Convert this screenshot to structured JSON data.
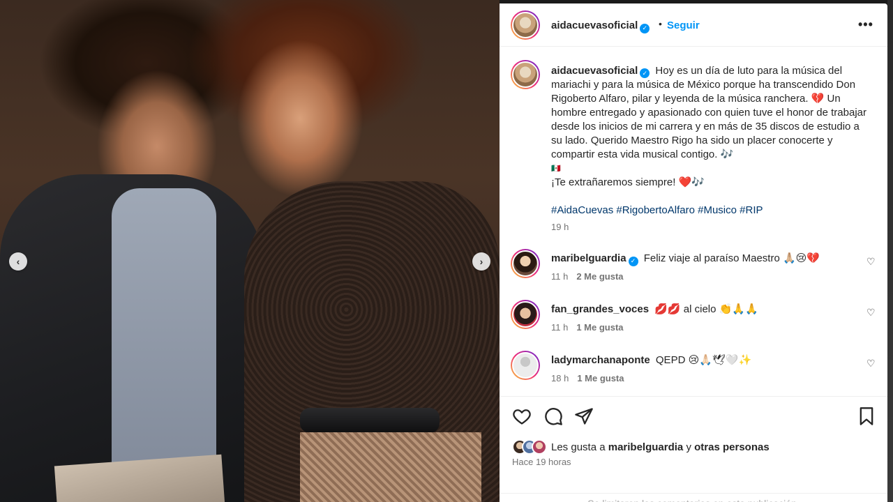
{
  "post": {
    "username": "aidacuevasoficial",
    "follow_label": "Seguir",
    "more_label": "•••",
    "dot": "•"
  },
  "caption": {
    "username": "aidacuevasoficial",
    "line1": "Hoy es un día de luto para la música del mariachi y para la música de México porque ha transcendido Don Rigoberto Alfaro, pilar y leyenda de la música ranchera. 💔 Un hombre entregado y apasionado con quien tuve el honor de trabajar desde los inicios de mi carrera y en más de 35 discos de estudio a su lado. Querido Maestro Rigo ha sido un placer conocerte y compartir esta vida musical contigo. 🎶",
    "flag": "🇲🇽",
    "line2": "¡Te extrañaremos siempre! ❤️🎶",
    "hashtags": "#AidaCuevas #RigobertoAlfaro #Musico #RIP",
    "time": "19 h"
  },
  "comments": [
    {
      "username": "maribelguardia",
      "verified": true,
      "text": "Feliz viaje al paraíso Maestro 🙏🏼😢💔",
      "time": "11 h",
      "likes": "2 Me gusta"
    },
    {
      "username": "fan_grandes_voces",
      "verified": false,
      "text": "💋💋 al cielo 👏🙏🙏",
      "time": "11 h",
      "likes": "1 Me gusta"
    },
    {
      "username": "ladymarchanaponte",
      "verified": false,
      "text": "QEPD 😢🙏🏻🕊🤍✨",
      "time": "18 h",
      "likes": "1 Me gusta"
    }
  ],
  "likes": {
    "prefix": "Les gusta a",
    "user": "maribelguardia",
    "connector": "y",
    "others": "otras personas"
  },
  "post_time": "Hace 19 horas",
  "footer_note": "Se limitaron los comentarios en esta publicación.",
  "icons": [
    "heart-icon",
    "comment-icon",
    "share-icon",
    "bookmark-icon",
    "verified-icon",
    "chevron-left-icon",
    "chevron-right-icon"
  ],
  "colors": {
    "link": "#0095f6",
    "hashtag": "#00376b",
    "muted": "#737373"
  }
}
